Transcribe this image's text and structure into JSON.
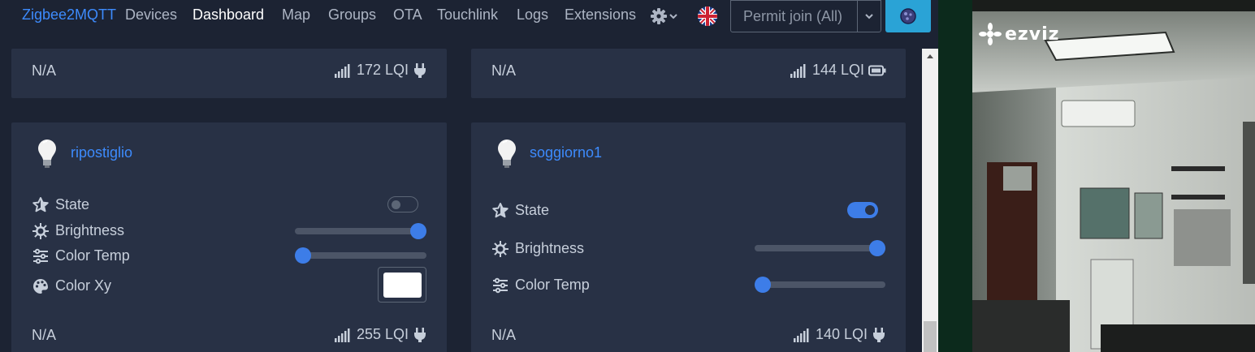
{
  "nav": {
    "brand": "Zigbee2MQTT",
    "items": [
      "Devices",
      "Dashboard",
      "Map",
      "Groups",
      "OTA",
      "Touchlink",
      "Logs",
      "Extensions"
    ],
    "active": "Dashboard",
    "settings_icon": "gear-icon",
    "language_icon": "uk-flag-icon",
    "permit_join_label": "Permit join (All)",
    "permit_chevron_icon": "chevron-down-icon",
    "action_icon": "theme-icon"
  },
  "cards": [
    {
      "footer": {
        "status": "N/A",
        "lqi": "172 LQI",
        "power_icon": "plug-icon"
      }
    },
    {
      "footer": {
        "status": "N/A",
        "lqi": "144 LQI",
        "power_icon": "battery-icon"
      }
    },
    {
      "name": "ripostiglio",
      "icon": "lightbulb-icon",
      "rows": {
        "state": {
          "label": "State",
          "on": false
        },
        "brightness": {
          "label": "Brightness",
          "level": 1.0
        },
        "color_temp": {
          "label": "Color Temp",
          "level": 0.0
        },
        "color_xy": {
          "label": "Color Xy",
          "color": "#ffffff"
        }
      },
      "footer": {
        "status": "N/A",
        "lqi": "255 LQI",
        "power_icon": "plug-icon"
      }
    },
    {
      "name": "soggiorno1",
      "icon": "lightbulb-icon",
      "rows": {
        "state": {
          "label": "State",
          "on": true
        },
        "brightness": {
          "label": "Brightness",
          "level": 1.0
        },
        "color_temp": {
          "label": "Color Temp",
          "level": 0.0
        }
      },
      "footer": {
        "status": "N/A",
        "lqi": "140 LQI",
        "power_icon": "plug-icon"
      }
    }
  ],
  "camera": {
    "logo_text": "ezviz"
  },
  "colors": {
    "accent": "#3d8bfd",
    "toggle_on": "#3d7de8",
    "card_bg": "#283145",
    "page_bg": "#1c2333",
    "action_button": "#2aa3d6"
  }
}
